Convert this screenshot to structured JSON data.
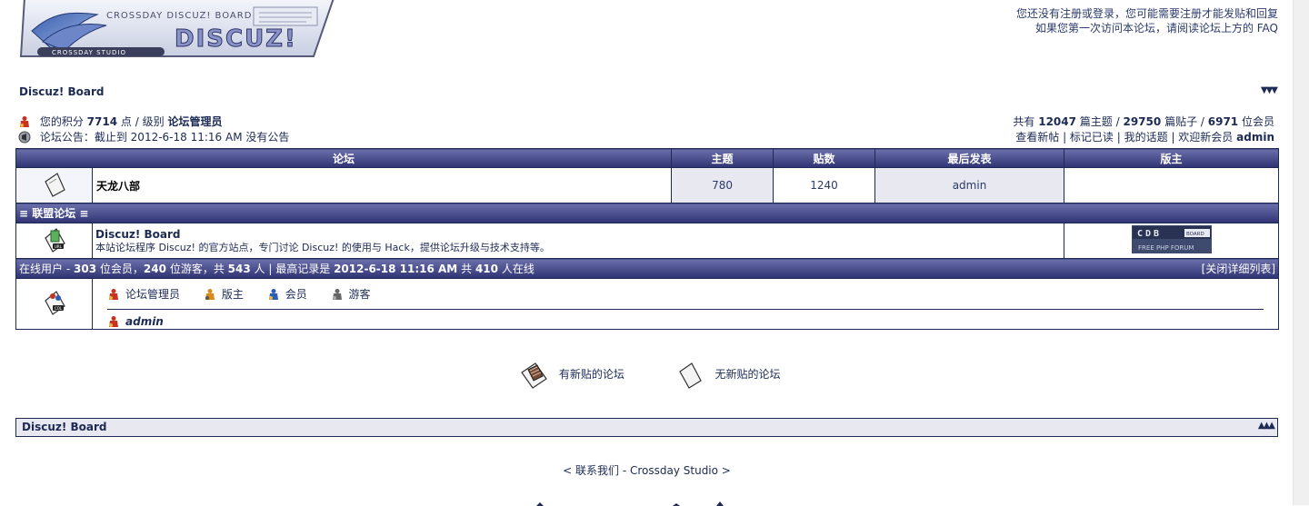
{
  "logo": {
    "board_text": "CROSSDAY DISCUZ! BOARD",
    "main_text": "DISCUZ!",
    "studio_text": "CROSSDAY STUDIO"
  },
  "header": {
    "notice_line1": "您还没有注册或登录，您可能需要注册才能发贴和回复",
    "notice_line2": "如果您第一次访问本论坛，请阅读论坛上方的 FAQ"
  },
  "nav": {
    "title": "Discuz! Board",
    "arrows": "▼▼▼"
  },
  "user": {
    "points_label": "您的积分",
    "points": "7714",
    "points_unit": "点",
    "level_label": "/ 级别",
    "level": "论坛管理员",
    "announce_label": "论坛公告：截止到",
    "announce_time": "2012-6-18 11:16 AM",
    "announce_suffix": "没有公告"
  },
  "stats": {
    "prefix": "共有",
    "topics": "12047",
    "topics_label": "篇主题 /",
    "posts": "29750",
    "posts_label": "篇贴子 /",
    "members": "6971",
    "members_label": "位会员",
    "link_new": "查看新帖",
    "link_mark": "标记已读",
    "link_mine": "我的话题",
    "welcome": "欢迎新会员",
    "new_member": "admin"
  },
  "table": {
    "headers": [
      "论坛",
      "主题",
      "贴数",
      "最后发表",
      "版主"
    ],
    "forums": [
      {
        "name": "天龙八部",
        "topics": "780",
        "posts": "1240",
        "last_post": "admin",
        "moderator": ""
      }
    ]
  },
  "partners": {
    "title": "≡ 联盟论坛 ≡",
    "items": [
      {
        "name": "Discuz! Board",
        "desc": "本站论坛程序 Discuz! 的官方站点，专门讨论 Discuz! 的使用与 Hack，提供论坛升级与技术支持等。",
        "badge_top": "CDB",
        "badge_board": "BOARD",
        "badge_bottom": "FREE PHP FORUM"
      }
    ]
  },
  "online": {
    "label": "在线用户",
    "dash": "-",
    "members": "303",
    "members_label": "位会员，",
    "guests": "240",
    "guests_label": "位游客，共",
    "total": "543",
    "total_label": "人 | 最高记录是",
    "record_time": "2012-6-18 11:16 AM",
    "record_mid": "共",
    "record": "410",
    "record_suffix": "人在线",
    "close_link": "[关闭详细列表]",
    "legend": [
      "论坛管理员",
      "版主",
      "会员",
      "游客"
    ],
    "users": [
      "admin"
    ],
    "legend_colors": [
      "#c8321e",
      "#d88a1a",
      "#2a5fb8",
      "#555555"
    ]
  },
  "states": {
    "new_label": "有新贴的论坛",
    "none_label": "无新贴的论坛"
  },
  "footer": {
    "bar_title": "Discuz! Board",
    "bar_arrows": "▲▲▲",
    "contact": "< 联系我们",
    "sep": " - ",
    "studio": "Crossday Studio >"
  }
}
